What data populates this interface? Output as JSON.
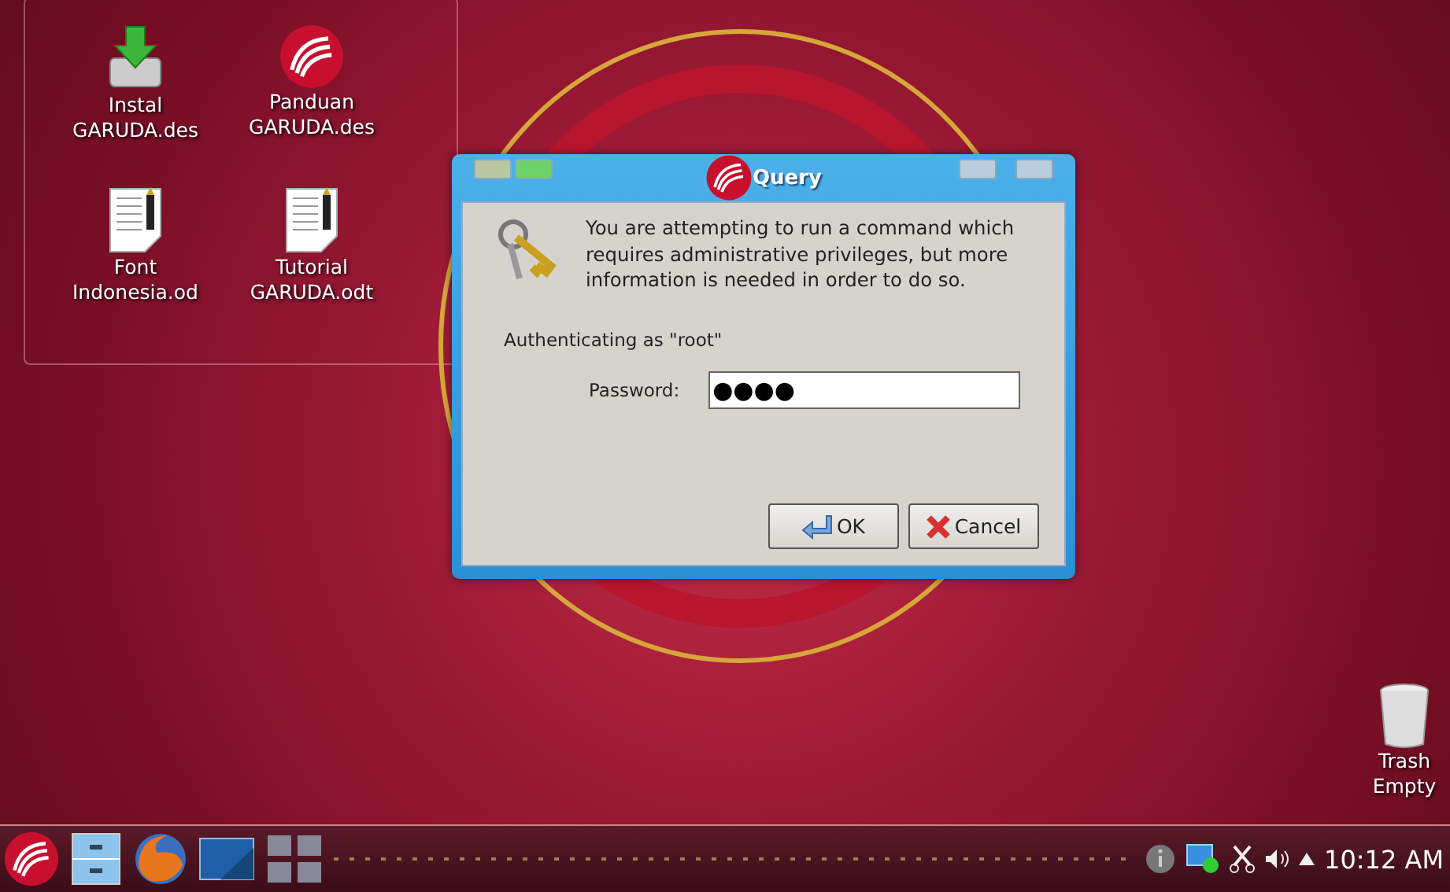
{
  "desktop_icons": [
    {
      "kind": "installer",
      "lines": [
        "Instal",
        "GARUDA.des"
      ]
    },
    {
      "kind": "logo",
      "lines": [
        "Panduan",
        "GARUDA.des"
      ]
    },
    {
      "kind": "document",
      "lines": [
        "Font",
        "Indonesia.od"
      ]
    },
    {
      "kind": "document",
      "lines": [
        "Tutorial",
        "GARUDA.odt"
      ]
    }
  ],
  "trash": {
    "lines": [
      "Trash",
      "Empty"
    ]
  },
  "dialog": {
    "title": "Query",
    "message": "You are attempting to run a command which requires administrative privileges, but more information is needed in order to do so.",
    "auth": "Authenticating as \"root\"",
    "password_label": "Password:",
    "password_value": "●●●●",
    "buttons": [
      {
        "kind": "ok",
        "label": "OK"
      },
      {
        "kind": "cancel",
        "label": "Cancel"
      }
    ]
  },
  "taskbar": {
    "clock": "10:12 AM"
  }
}
